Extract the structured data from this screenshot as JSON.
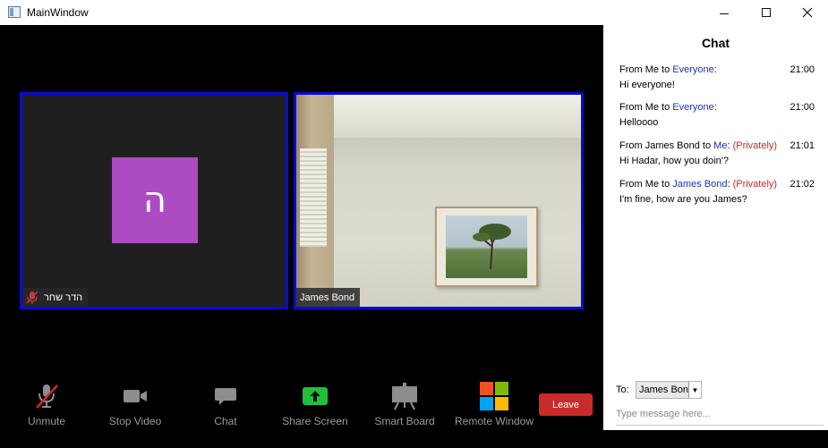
{
  "window": {
    "title": "MainWindow",
    "minimize_glyph": "—",
    "maximize_glyph": "☐",
    "close_glyph": "✕"
  },
  "participants": [
    {
      "name": "הדר שחר",
      "initial": "ה",
      "muted": true,
      "avatar_color": "#ad4cc2"
    },
    {
      "name": "James Bond",
      "muted": false
    }
  ],
  "toolbar": {
    "unmute": "Unmute",
    "stop_video": "Stop Video",
    "chat": "Chat",
    "share_screen": "Share Screen",
    "smart_board": "Smart Board",
    "remote_window": "Remote Window",
    "leave": "Leave"
  },
  "chat": {
    "title": "Chat",
    "messages": [
      {
        "from": "From Me to ",
        "to": "Everyone",
        "suffix": ":",
        "private": "",
        "time": "21:00",
        "text": "Hi everyone!"
      },
      {
        "from": "From Me to ",
        "to": "Everyone",
        "suffix": ":",
        "private": "",
        "time": "21:00",
        "text": "Helloooo"
      },
      {
        "from": "From James Bond to ",
        "to": "Me",
        "suffix": ":",
        "private": "(Privately)",
        "time": "21:01",
        "text": "Hi Hadar, how you doin'?"
      },
      {
        "from": "From Me to ",
        "to": "James Bond",
        "suffix": ":",
        "private": "(Privately)",
        "time": "21:02",
        "text": "I'm fine, how are you James?"
      }
    ],
    "to_label": "To:",
    "to_value": "James Bon",
    "input_placeholder": "Type message here..."
  },
  "colors": {
    "tile_border": "#0a0ad6",
    "leave": "#c82b2b",
    "recipient_blue": "#1e2fc2",
    "private_red": "#d02525",
    "share_green": "#1fbf3c"
  }
}
